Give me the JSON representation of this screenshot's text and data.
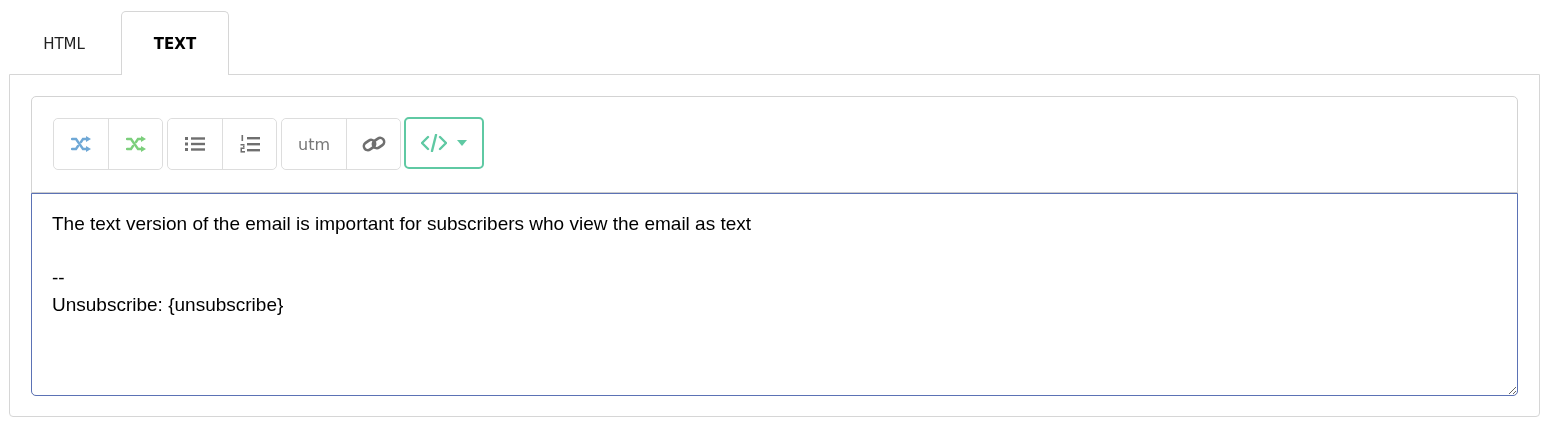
{
  "tabs": [
    {
      "label": "HTML",
      "selected": false
    },
    {
      "label": "TEXT",
      "selected": true
    }
  ],
  "toolbar": {
    "groups": [
      {
        "buttons": [
          {
            "kind": "shuffle",
            "color": "#6fa8d6"
          },
          {
            "kind": "shuffle",
            "color": "#7ccf7c"
          }
        ]
      },
      {
        "buttons": [
          {
            "kind": "bullet-list"
          },
          {
            "kind": "numbered-list"
          }
        ]
      },
      {
        "buttons": [
          {
            "kind": "text",
            "label": "utm"
          },
          {
            "kind": "link"
          }
        ]
      },
      {
        "buttons": [
          {
            "kind": "code-dropdown",
            "color": "#5fc9a3"
          }
        ]
      }
    ]
  },
  "editor": {
    "value": "The text version of the email is important for subscribers who view the email as text\n\n--\nUnsubscribe: {unsubscribe}"
  }
}
